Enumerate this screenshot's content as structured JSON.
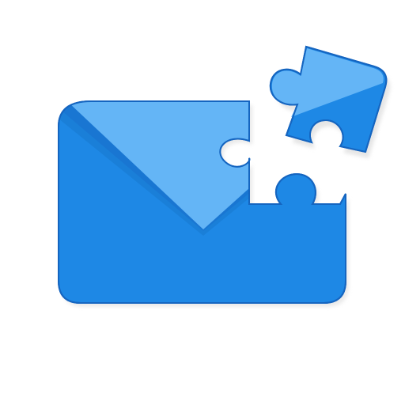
{
  "app_icon": {
    "icon_name": "mail-puzzle-extension-icon",
    "colors": {
      "background": "#ffffff",
      "envelope_body": "#1e88e5",
      "envelope_flap": "#64b5f6",
      "flap_shadow": "#1976d2",
      "outline": "#1565c0",
      "puzzle_light": "#64b5f6",
      "puzzle_dark": "#1e88e5",
      "drop_shadow": "#e3e3e3"
    }
  }
}
